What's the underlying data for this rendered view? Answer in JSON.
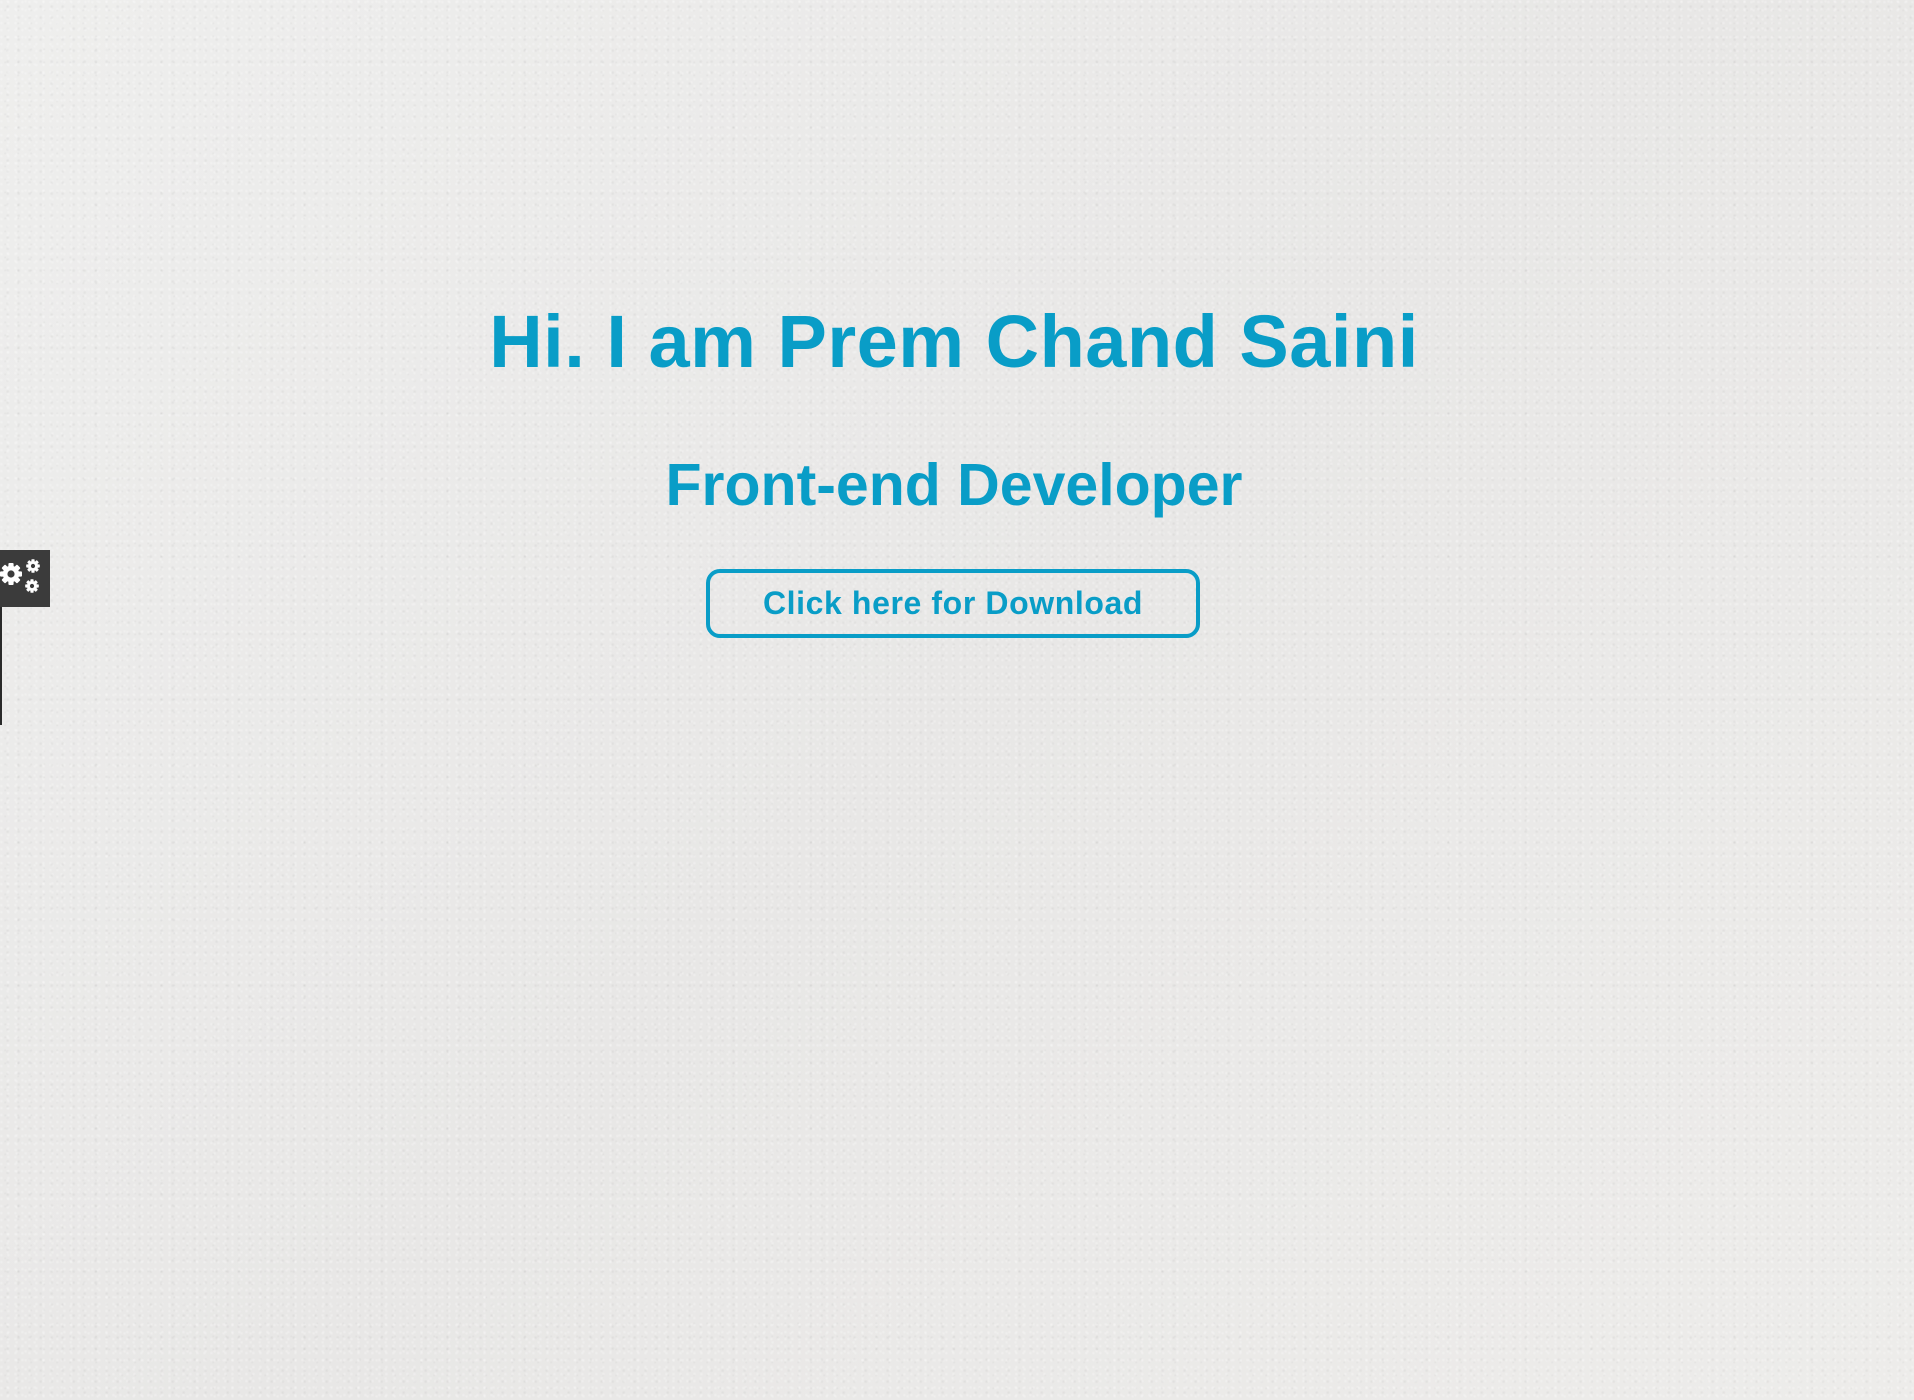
{
  "hero": {
    "name": "Hi. I am Prem Chand Saini",
    "role": "Front-end Developer",
    "download_label": "Click here for Download"
  },
  "settings_tab": {
    "icon": "gears-icon"
  },
  "colors": {
    "accent": "#099dc7",
    "settings_tab_bg": "#3b3b3b",
    "page_bg": "#ecebea"
  }
}
